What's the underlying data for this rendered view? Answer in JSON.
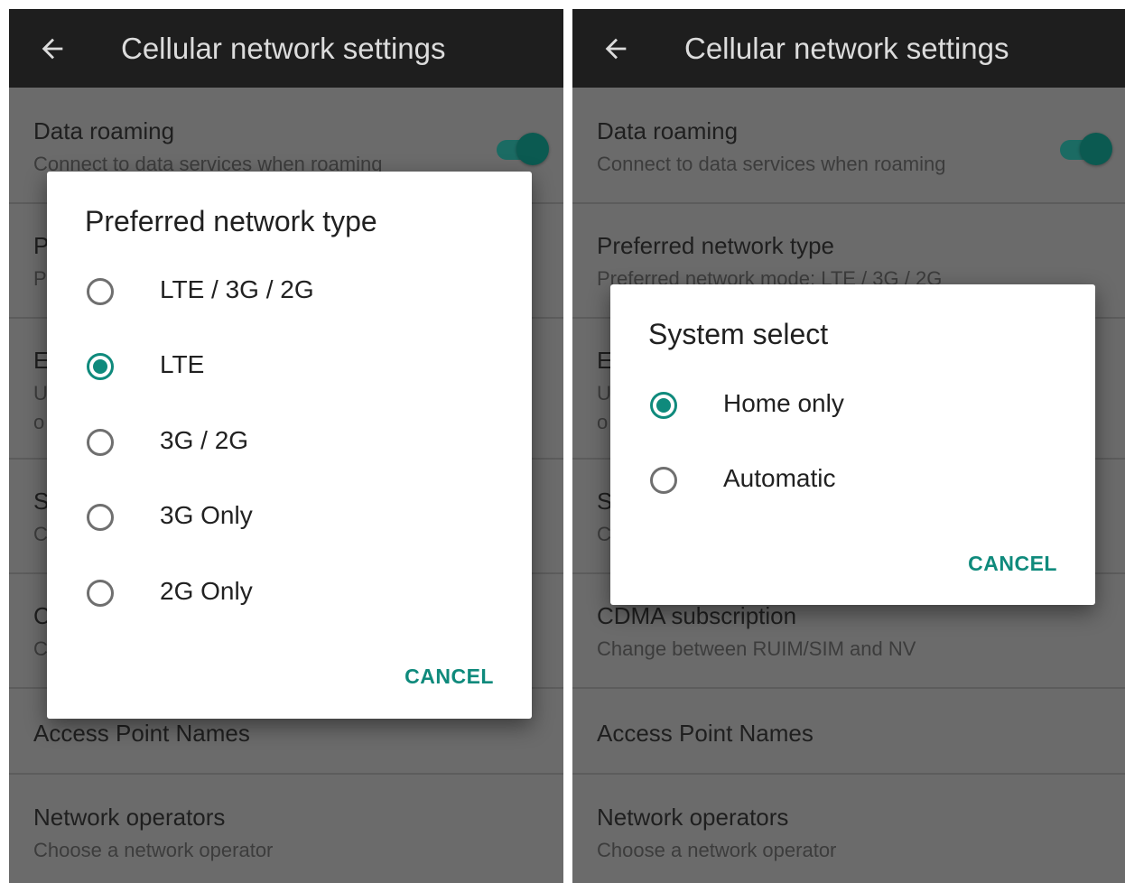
{
  "appbar": {
    "title": "Cellular network settings"
  },
  "settings": {
    "data_roaming": {
      "title": "Data roaming",
      "summary": "Connect to data services when roaming",
      "enabled": true
    },
    "preferred_network": {
      "title": "Preferred network type",
      "summary": "Preferred network mode: LTE / 3G / 2G"
    },
    "system_select_partial": {
      "title": "S",
      "summary": "C"
    },
    "enhanced_partial": {
      "title": "E",
      "summary1": "U",
      "summary2": "o"
    },
    "cdma": {
      "title": "CDMA subscription",
      "summary": "Change between RUIM/SIM and NV"
    },
    "apn": {
      "title": "Access Point Names"
    },
    "operators": {
      "title": "Network operators",
      "summary": "Choose a network operator"
    }
  },
  "left_partial": {
    "preferred_title": "P",
    "preferred_summary": "P",
    "cdma_title": "C",
    "cdma_summary": "C"
  },
  "dialog_network_type": {
    "title": "Preferred network type",
    "options": [
      {
        "label": "LTE / 3G / 2G",
        "checked": false
      },
      {
        "label": "LTE",
        "checked": true
      },
      {
        "label": "3G / 2G",
        "checked": false
      },
      {
        "label": "3G Only",
        "checked": false
      },
      {
        "label": "2G Only",
        "checked": false
      }
    ],
    "cancel": "CANCEL"
  },
  "dialog_system_select": {
    "title": "System select",
    "options": [
      {
        "label": "Home only",
        "checked": true
      },
      {
        "label": "Automatic",
        "checked": false
      }
    ],
    "cancel": "CANCEL"
  },
  "colors": {
    "accent": "#0f8a7c",
    "appbar": "#1e1e1e",
    "scrim_background": "#6b6b6b"
  },
  "icons": {
    "back": "arrow-left-icon"
  }
}
